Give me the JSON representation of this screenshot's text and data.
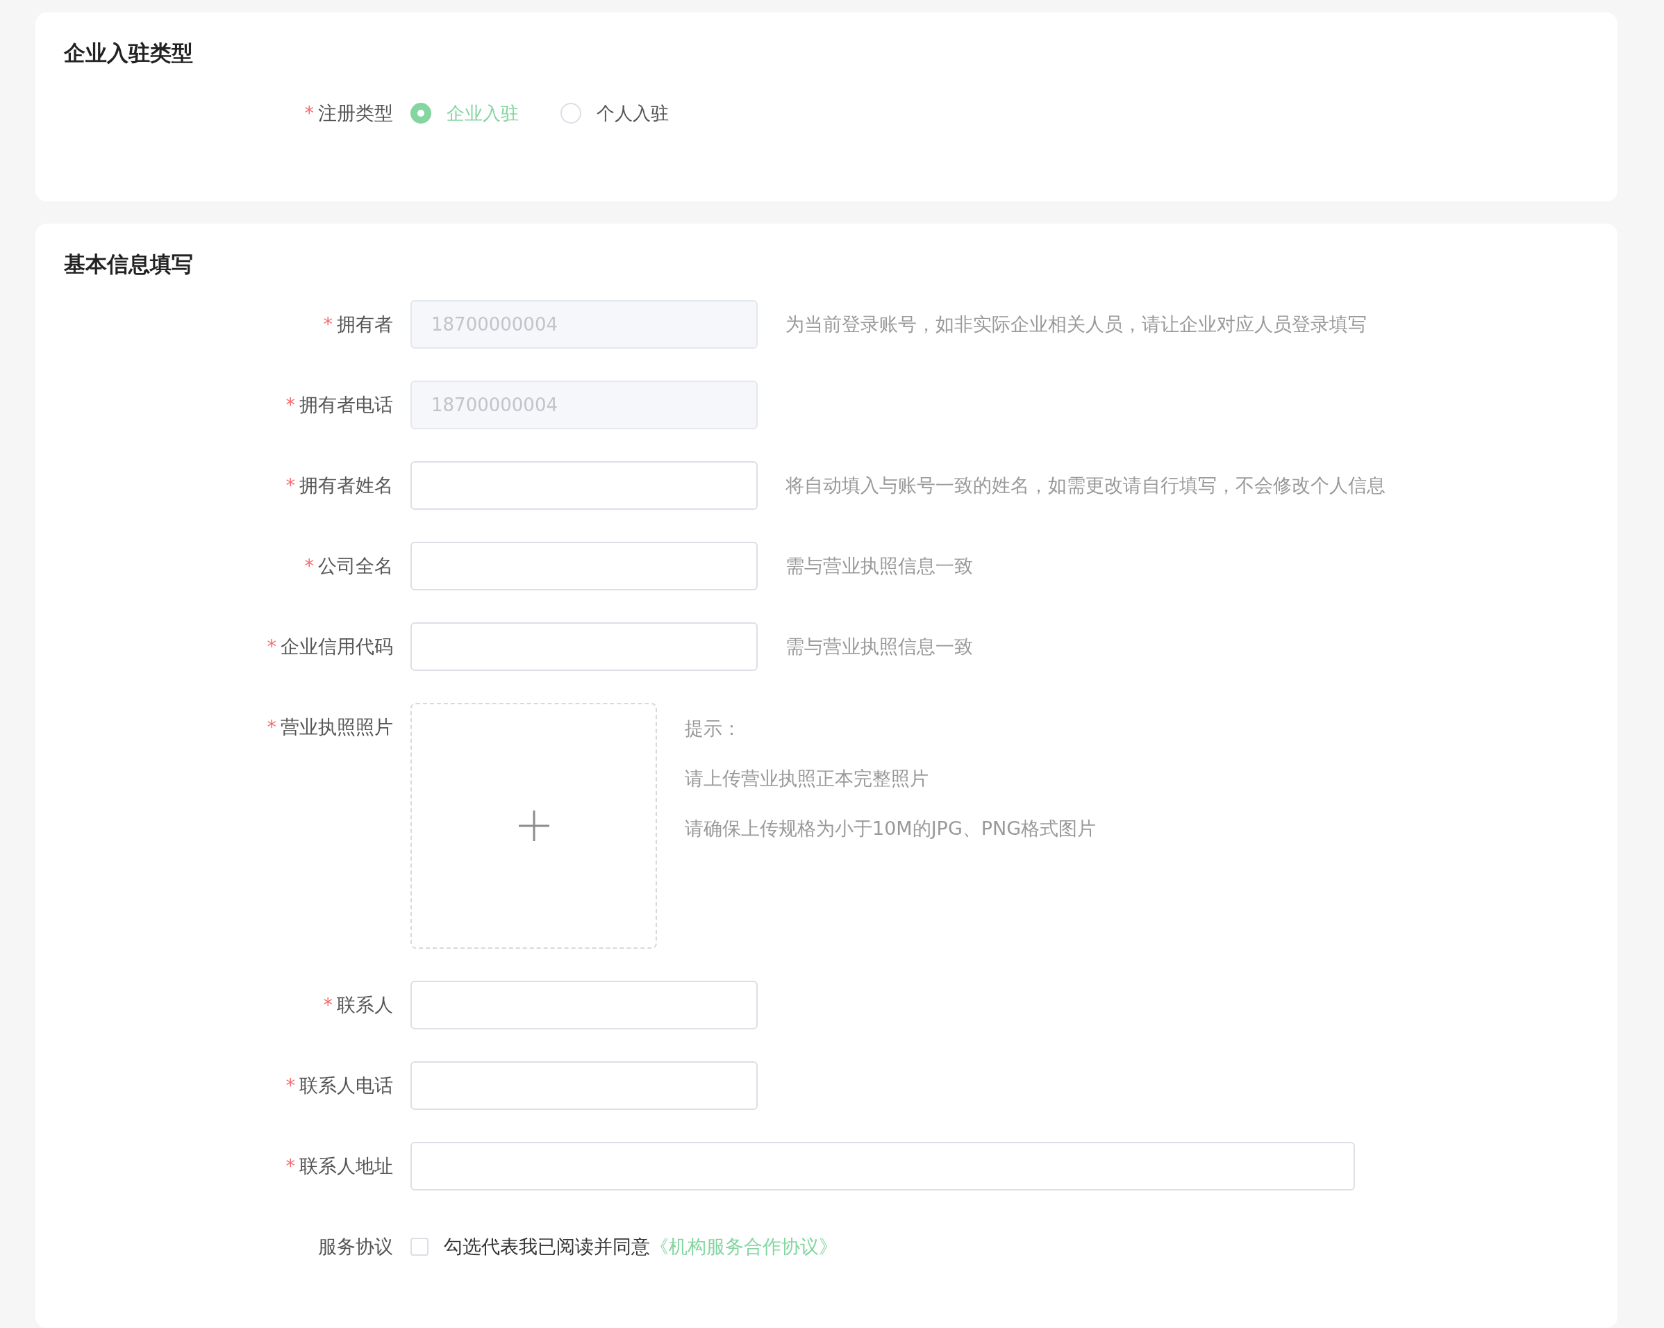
{
  "sections": [
    {
      "title": "企业入驻类型",
      "fields": [
        {
          "kind": "radio",
          "required_mark": "*",
          "label": "注册类型",
          "options": [
            {
              "label": "企业入驻",
              "selected": true
            },
            {
              "label": "个人入驻",
              "selected": false
            }
          ]
        }
      ]
    },
    {
      "title": "基本信息填写",
      "fields": [
        {
          "kind": "input",
          "required_mark": "*",
          "label": "拥有者",
          "value": "18700000004",
          "disabled": true,
          "hint": "为当前登录账号，如非实际企业相关人员，请让企业对应人员登录填写"
        },
        {
          "kind": "input",
          "required_mark": "*",
          "label": "拥有者电话",
          "value": "18700000004",
          "disabled": true
        },
        {
          "kind": "input",
          "required_mark": "*",
          "label": "拥有者姓名",
          "hint": "将自动填入与账号一致的姓名，如需更改请自行填写，不会修改个人信息"
        },
        {
          "kind": "input",
          "required_mark": "*",
          "label": "公司全名",
          "hint": "需与营业执照信息一致"
        },
        {
          "kind": "input",
          "required_mark": "*",
          "label": "企业信用代码",
          "hint": "需与营业执照信息一致"
        },
        {
          "kind": "upload",
          "required_mark": "*",
          "label": "营业执照照片",
          "hints": [
            "提示：",
            "请上传营业执照正本完整照片",
            "请确保上传规格为小于10M的JPG、PNG格式图片"
          ]
        },
        {
          "kind": "input",
          "required_mark": "*",
          "label": "联系人"
        },
        {
          "kind": "input",
          "required_mark": "*",
          "label": "联系人电话"
        },
        {
          "kind": "input",
          "required_mark": "*",
          "label": "联系人地址",
          "wide": true
        },
        {
          "kind": "checkbox",
          "label": "服务协议",
          "checked": false,
          "text": "勾选代表我已阅读并同意",
          "link": "《机构服务合作协议》"
        }
      ]
    }
  ]
}
